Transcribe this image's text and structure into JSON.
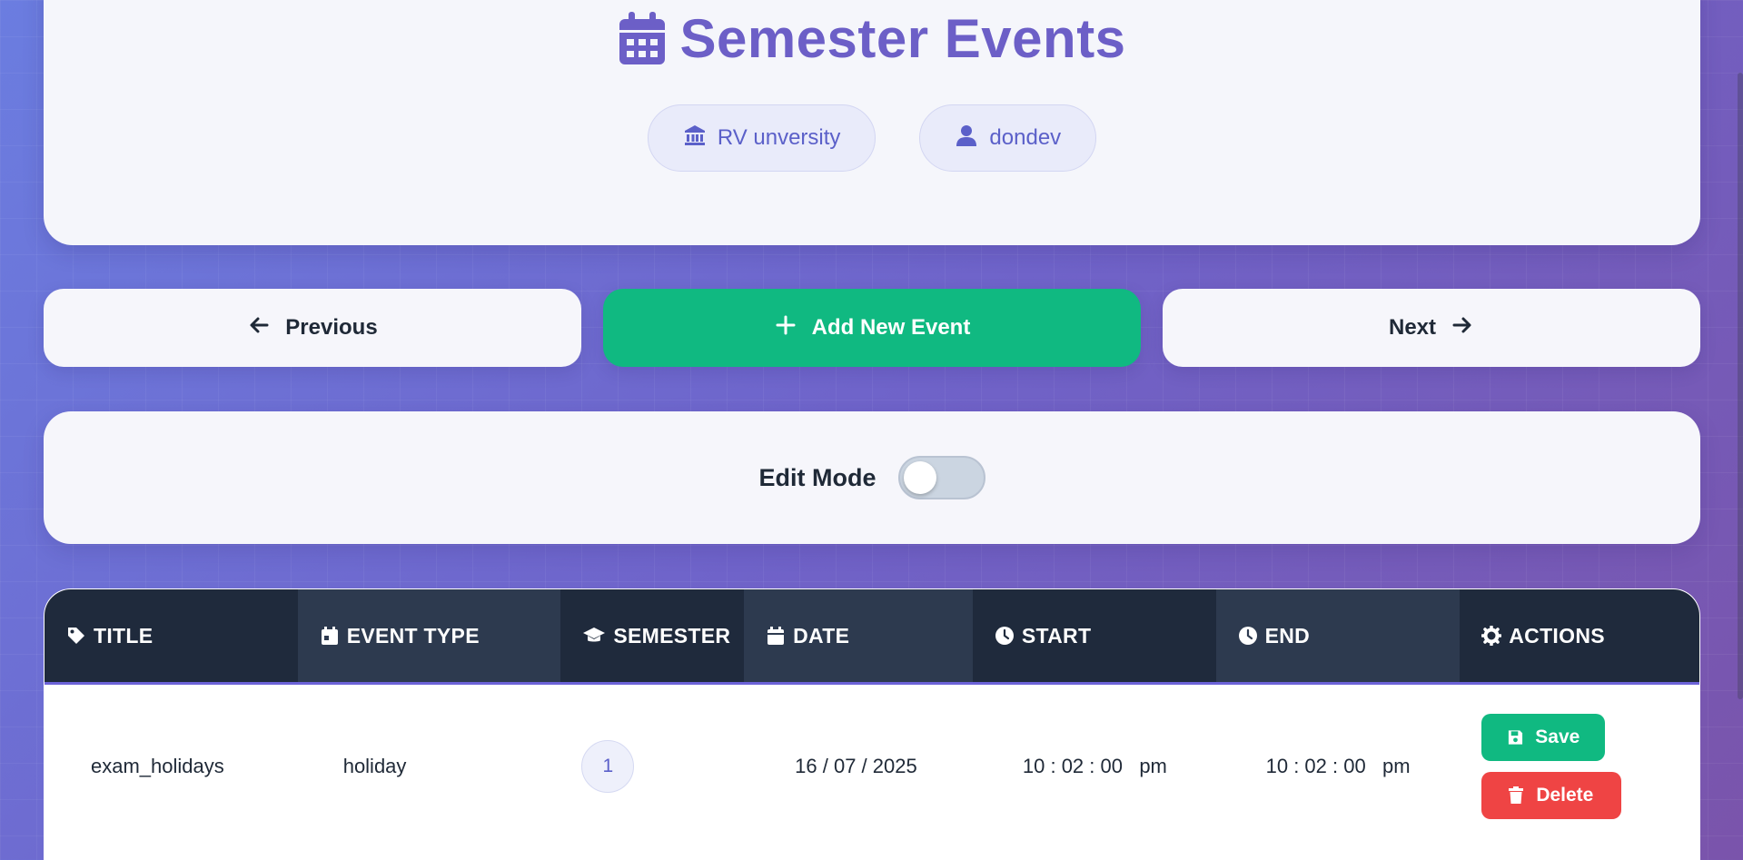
{
  "header": {
    "title": "Semester Events",
    "title_icon": "calendar-icon",
    "university": "RV unversity",
    "university_icon": "university-icon",
    "user": "dondev",
    "user_icon": "user-icon"
  },
  "nav": {
    "previous_label": "Previous",
    "add_label": "Add New Event",
    "next_label": "Next"
  },
  "edit_mode": {
    "label": "Edit Mode",
    "enabled": false
  },
  "table": {
    "columns": [
      {
        "label": "TITLE",
        "icon": "tag-icon"
      },
      {
        "label": "EVENT TYPE",
        "icon": "calendar-day-icon"
      },
      {
        "label": "SEMESTER",
        "icon": "graduation-cap-icon"
      },
      {
        "label": "DATE",
        "icon": "calendar-icon"
      },
      {
        "label": "START",
        "icon": "clock-icon"
      },
      {
        "label": "END",
        "icon": "clock-icon"
      },
      {
        "label": "ACTIONS",
        "icon": "gear-icon"
      }
    ],
    "rows": [
      {
        "title": "exam_holidays",
        "event_type": "holiday",
        "semester": "1",
        "date": "16 / 07 / 2025",
        "start": "10 : 02 : 00   pm",
        "end": "10 : 02 : 00   pm",
        "save_label": "Save",
        "delete_label": "Delete"
      }
    ]
  },
  "colors": {
    "accent": "#6c5fc7",
    "success": "#10b981",
    "danger": "#ef4444",
    "table_header": "#1f2a3c"
  }
}
